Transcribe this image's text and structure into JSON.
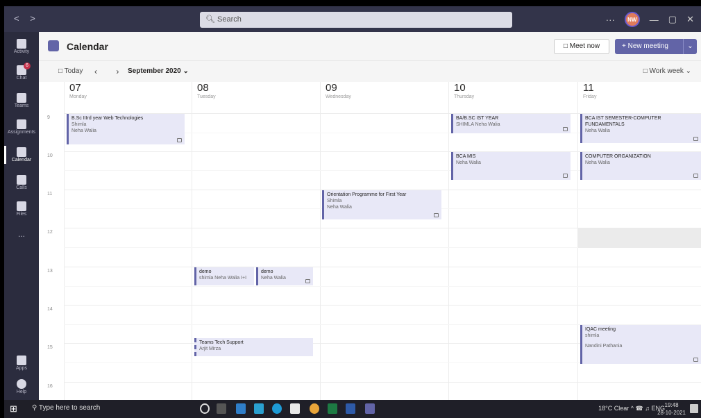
{
  "titlebar": {
    "search_placeholder": "Search",
    "avatar_initials": "NW"
  },
  "rail": {
    "items": [
      {
        "label": "Activity"
      },
      {
        "label": "Chat",
        "badge": "6"
      },
      {
        "label": "Teams"
      },
      {
        "label": "Assignments"
      },
      {
        "label": "Calendar"
      },
      {
        "label": "Calls"
      },
      {
        "label": "Files"
      },
      {
        "label": "..."
      },
      {
        "label": "Apps"
      },
      {
        "label": "Help"
      }
    ]
  },
  "header": {
    "title": "Calendar",
    "meet_now": "Meet now",
    "new_meeting": "+ New meeting"
  },
  "toolbar": {
    "today": "Today",
    "month": "September 2020",
    "view": "Work week"
  },
  "days": [
    {
      "num": "07",
      "name": "Monday"
    },
    {
      "num": "08",
      "name": "Tuesday"
    },
    {
      "num": "09",
      "name": "Wednesday"
    },
    {
      "num": "10",
      "name": "Thursday"
    },
    {
      "num": "11",
      "name": "Friday"
    }
  ],
  "hours": [
    "9",
    "10",
    "11",
    "12",
    "13",
    "14",
    "15",
    "16"
  ],
  "events": [
    {
      "title": "B.Sc IIIrd year Web Technologies",
      "line2": "Shimla",
      "line3": "Neha Walia"
    },
    {
      "title": "BA/B.SC IST YEAR",
      "line2": "SHIMLA  Neha Walia",
      "line3": ""
    },
    {
      "title": "BCA IST SEMESTER-COMPUTER FUNDAMENTALS",
      "line2": "Neha Walia",
      "line3": ""
    },
    {
      "title": "BCA MIS",
      "line2": "Neha Walia",
      "line3": ""
    },
    {
      "title": "COMPUTER ORGANIZATION",
      "line2": "Neha Walia",
      "line3": ""
    },
    {
      "title": "Orientation Programme for First Year",
      "line2": "Shimla",
      "line3": "Neha Walia"
    },
    {
      "title": "demo",
      "line2": "shimla  Neha Walia  I+I",
      "line3": ""
    },
    {
      "title": "demo",
      "line2": "Neha Walia",
      "line3": ""
    },
    {
      "title": "Teams Tech Support",
      "line2": "Arjit Mirza",
      "line3": ""
    },
    {
      "title": "IQAC meeting",
      "line2": "shimla",
      "line3": "Nandini Pathania"
    }
  ],
  "taskbar": {
    "search": "Type here to search",
    "weather": "18°C  Clear",
    "lang": "ENG",
    "time": "19:48",
    "date": "28-10-2021"
  }
}
